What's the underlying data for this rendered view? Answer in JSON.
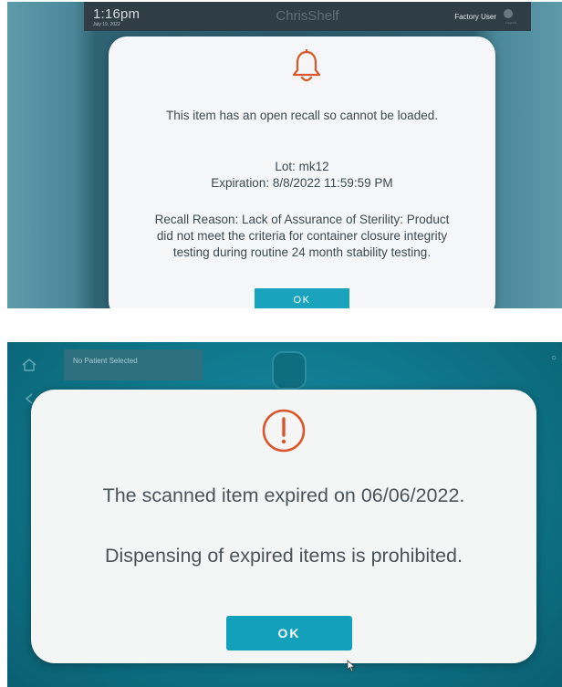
{
  "screen1": {
    "topbar": {
      "time": "1:16pm",
      "date": "July 19, 2022",
      "app_name": "ChrisShelf",
      "user": "Factory User",
      "logout_label": "Logout"
    },
    "modal": {
      "icon": "bell-icon",
      "message": "This item has an open recall so cannot be loaded.",
      "lot": "Lot: mk12",
      "expiration": "Expiration: 8/8/2022 11:59:59 PM",
      "recall_reason": "Recall Reason: Lack of Assurance of Sterility: Product did not meet the criteria for container closure integrity testing during routine 24 month stability testing.",
      "ok_label": "OK"
    }
  },
  "screen2": {
    "header": {
      "patient_label": "No Patient Selected"
    },
    "modal": {
      "icon": "exclamation-circle-icon",
      "message": "The scanned item expired on 06/06/2022.",
      "warning": "Dispensing of expired items is prohibited.",
      "ok_label": "OK"
    }
  },
  "colors": {
    "alert_orange": "#d9552b",
    "button_teal": "#13a0bb",
    "teal_background": "#10798e"
  }
}
